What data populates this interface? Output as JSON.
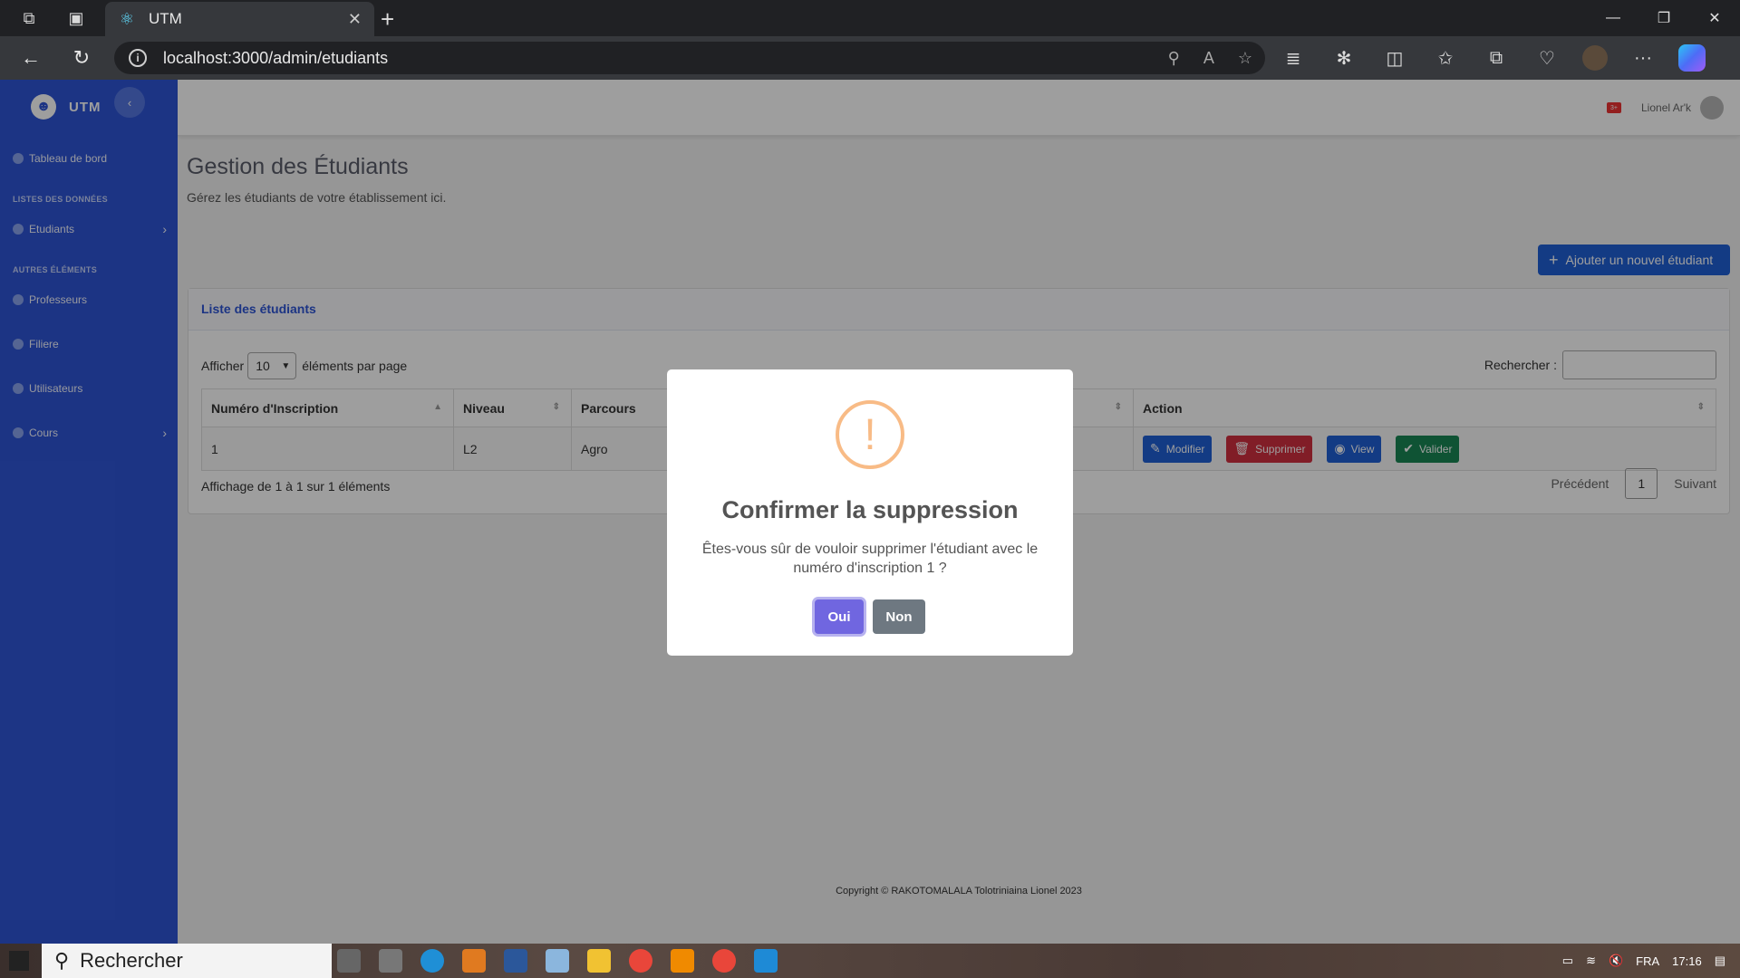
{
  "browser": {
    "tab_title": "UTM",
    "url": "localhost:3000/admin/etudiants"
  },
  "sidebar": {
    "brand": "UTM",
    "items": [
      {
        "label": "Tableau de bord"
      },
      {
        "label": "Etudiants"
      },
      {
        "label": "Professeurs"
      },
      {
        "label": "Filiere"
      },
      {
        "label": "Utilisateurs"
      },
      {
        "label": "Cours"
      }
    ],
    "headings": [
      "LISTES DES DONNÉES",
      "AUTRES ÉLÉMENTS"
    ]
  },
  "topbar": {
    "user_name": "Lionel Ar'k",
    "notif_badge": "3+"
  },
  "page": {
    "title": "Gestion des Étudiants",
    "subtitle": "Gérez les étudiants de votre établissement ici.",
    "add_button": "Ajouter un nouvel étudiant"
  },
  "card": {
    "header": "Liste des étudiants",
    "show_label": "Afficher",
    "show_value": "10",
    "per_page_label": "éléments par page",
    "search_label": "Rechercher :",
    "columns": [
      "Numéro d'Inscription",
      "Niveau",
      "Parcours",
      "Action"
    ],
    "rows": [
      {
        "numero": "1",
        "niveau": "L2",
        "parcours": "Agro"
      }
    ],
    "actions": [
      "Modifier",
      "Supprimer",
      "View",
      "Valider"
    ],
    "info": "Affichage de 1 à 1 sur 1 éléments",
    "prev": "Précédent",
    "page": "1",
    "next": "Suivant"
  },
  "footer": {
    "text": "Copyright © RAKOTOMALALA Tolotriniaina Lionel 2023"
  },
  "modal": {
    "icon": "!",
    "title": "Confirmer la suppression",
    "text": "Êtes-vous sûr de vouloir supprimer l'étudiant avec le numéro d'inscription 1 ?",
    "yes": "Oui",
    "no": "Non"
  },
  "taskbar": {
    "search": "Rechercher",
    "lang": "FRA",
    "time": "17:16"
  },
  "colors": {
    "sidebar": "#2e55d6",
    "primary_button": "#1f5fd6",
    "danger_button": "#d1303f",
    "success_button": "#198754",
    "confirm_button": "#7066e0",
    "cancel_button": "#6e7881",
    "warning_icon": "#f8bb86"
  }
}
